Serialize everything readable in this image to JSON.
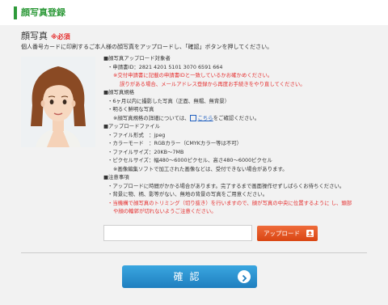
{
  "header": {
    "title": "顔写真登録"
  },
  "section": {
    "title": "顔写真",
    "required": "※必須",
    "intro": "個人番号カードに印刷するご本人様の顔写真をアップロードし、「確認」ボタンを押してください。"
  },
  "info": {
    "target_heading": "■顔写真アップロード対象者",
    "applicant_id": "・申請書ID：2821 4201 5101 3070 6591 664",
    "warn1": "※交付申請書に記載の申請書IDと一致しているかお確かめください。",
    "warn2": "誤りがある場合、メールアドレス登録から再度お手続きをやり直してください。",
    "spec_heading": "■顔写真規格",
    "spec1": "・6ヶ月以内に撮影した写真（正面、無帽、無背景）",
    "spec2": "・明るく鮮明な写真",
    "spec_detail_prefix": "※顔写真規格の詳細については、",
    "spec_detail_link": "こちら",
    "spec_detail_suffix": "をご確認ください。",
    "file_heading": "■アップロードファイル",
    "file1": "・ファイル形式　：jpeg",
    "file2": "・カラーモード　：RGBカラー（CMYKカラー等は不可）",
    "file3": "・ファイルサイズ：20KB〜7MB",
    "file4": "・ピクセルサイズ：幅480〜6000ピクセル、高さ480〜6000ピクセル",
    "file_note": "※画像編集ソフトで加工された画像などは、受付できない場合があります。",
    "notes_heading": "■注意事項",
    "note1": "・アップロードに時間がかかる場合があります。完了するまで画面操作せずしばらくお待ちください。",
    "note2": "・背景に物、柄、影等がない、無地の背景の写真をご用意ください。",
    "note3": "・当機構で顔写真のトリミング（切り抜き）を行いますので、顔が写真の中央に位置するように し、頭部",
    "note4": "や顔の輪郭が切れないようご注意ください。"
  },
  "upload": {
    "field_value": "",
    "button_label": "アップロード"
  },
  "confirm": {
    "label": "確認"
  },
  "colors": {
    "accent": "#2e9a3a",
    "warning": "#e53030",
    "upload": "#e55a22",
    "confirm": "#2a93d5"
  },
  "icons": [
    "external-link-icon",
    "upload-icon",
    "chevron-right-icon"
  ]
}
